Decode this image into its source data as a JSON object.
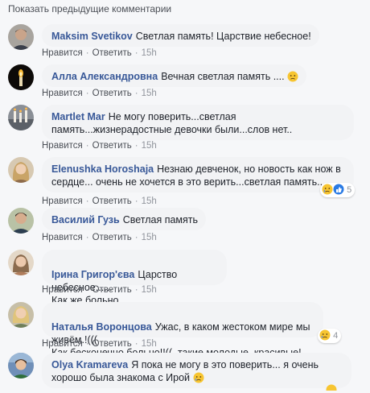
{
  "previous_link": "Показать предыдущие комментарии",
  "actions": {
    "like": "Нравится",
    "reply": "Ответить",
    "sep": "·"
  },
  "comments": [
    {
      "author": "Maksim Svetikov",
      "text": "Светлая память! Царствие небесное!",
      "time": "15h"
    },
    {
      "author": "Алла Александровна",
      "text": "Вечная светлая память ....",
      "time": "15h"
    },
    {
      "author": "Martlet Mar",
      "text": "Не могу поверить...светлая память...жизнерадостные девочки были...слов нет..",
      "time": "15h"
    },
    {
      "author": "Elenushka Horoshaja",
      "text": "Незнаю девченок, но новость как нож в сердце... очень не хочется в это верить...светлая память...",
      "time": "15h",
      "reactions": "5"
    },
    {
      "author": "Василий Гузь",
      "text": "Светлая память",
      "time": "15h"
    },
    {
      "author": "Ірина Григор'єва",
      "text": "Царство небесное......\nКак же больно....",
      "time": "15h"
    },
    {
      "author": "Наталья Воронцова",
      "text": "Ужас, в каком жестоком мире мы живём.!(((\nКак бесконечно больно!!((, такие молодые, красивые!",
      "time": "15h",
      "reactions": "4"
    },
    {
      "author": "Olya Kramareva",
      "text": "Я пока не могу в это поверить... я очень хорошо была знакома с Ирой",
      "time": ""
    }
  ]
}
